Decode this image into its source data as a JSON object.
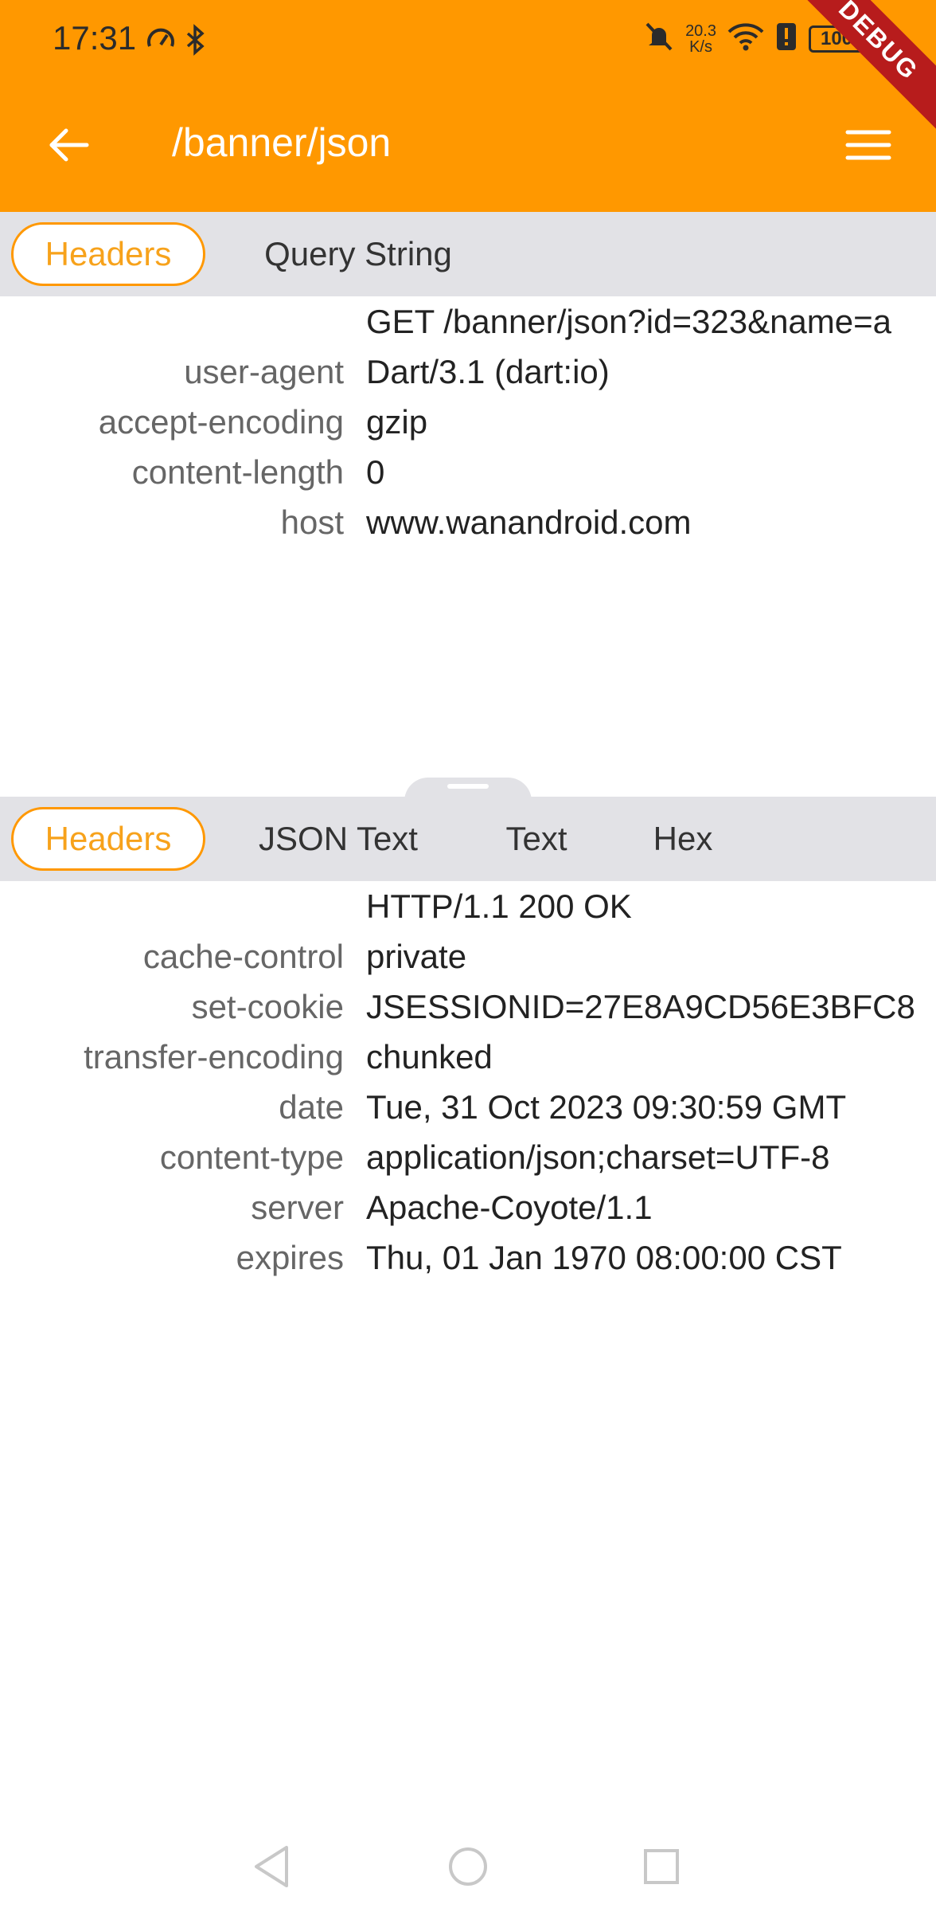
{
  "status_bar": {
    "time": "17:31",
    "net_speed_value": "20.3",
    "net_speed_unit": "K/s",
    "battery": "100"
  },
  "debug_banner": "DEBUG",
  "app_bar": {
    "title": "/banner/json",
    "back_icon": "arrow-left-icon",
    "menu_icon": "hamburger-menu-icon"
  },
  "colors": {
    "accent": "#FF9800",
    "tab_active_text": "#F7A21B",
    "tabbar_bg": "#E2E2E6"
  },
  "request": {
    "tabs": [
      {
        "label": "Headers",
        "active": true
      },
      {
        "label": "Query String",
        "active": false
      }
    ],
    "headers": [
      {
        "key": "",
        "value": "GET /banner/json?id=323&name=a"
      },
      {
        "key": "user-agent",
        "value": "Dart/3.1 (dart:io)"
      },
      {
        "key": "accept-encoding",
        "value": "gzip"
      },
      {
        "key": "content-length",
        "value": "0"
      },
      {
        "key": "host",
        "value": "www.wanandroid.com"
      }
    ]
  },
  "response": {
    "tabs": [
      {
        "label": "Headers",
        "active": true
      },
      {
        "label": "JSON Text",
        "active": false
      },
      {
        "label": "Text",
        "active": false
      },
      {
        "label": "Hex",
        "active": false
      }
    ],
    "headers": [
      {
        "key": "",
        "value": "HTTP/1.1 200 OK"
      },
      {
        "key": "cache-control",
        "value": "private"
      },
      {
        "key": "set-cookie",
        "value": "JSESSIONID=27E8A9CD56E3BFC8"
      },
      {
        "key": "transfer-encoding",
        "value": "chunked"
      },
      {
        "key": "date",
        "value": "Tue, 31 Oct 2023 09:30:59 GMT"
      },
      {
        "key": "content-type",
        "value": "application/json;charset=UTF-8"
      },
      {
        "key": "server",
        "value": "Apache-Coyote/1.1"
      },
      {
        "key": "expires",
        "value": "Thu, 01 Jan 1970 08:00:00 CST"
      }
    ]
  },
  "nav_bar": {
    "back_icon": "nav-back-triangle-icon",
    "home_icon": "nav-home-circle-icon",
    "recents_icon": "nav-recents-square-icon"
  }
}
